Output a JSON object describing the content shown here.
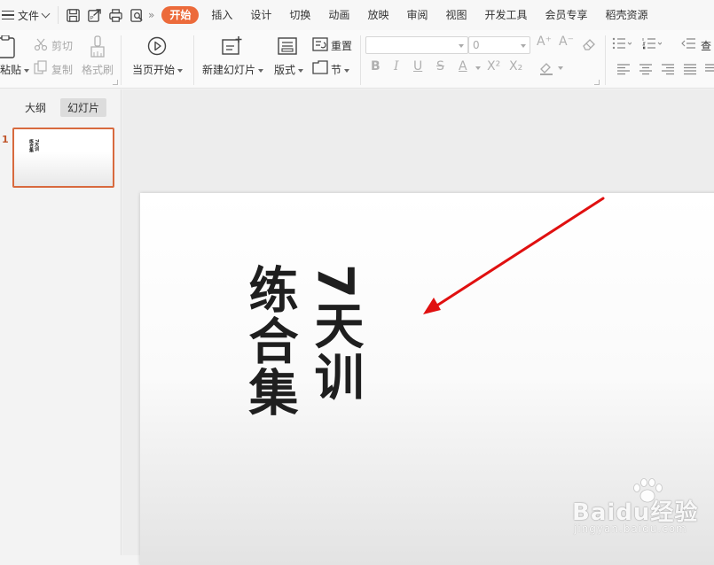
{
  "menubar": {
    "file_label": "文件",
    "more_label": "»",
    "quick_access_icons": [
      "save-icon",
      "export-icon",
      "print-icon",
      "print-preview-icon"
    ],
    "tabs": [
      {
        "label": "开始",
        "active": true
      },
      {
        "label": "插入"
      },
      {
        "label": "设计"
      },
      {
        "label": "切换"
      },
      {
        "label": "动画"
      },
      {
        "label": "放映"
      },
      {
        "label": "审阅"
      },
      {
        "label": "视图"
      },
      {
        "label": "开发工具"
      },
      {
        "label": "会员专享"
      },
      {
        "label": "稻壳资源"
      }
    ],
    "accent_color": "#ec6a3a"
  },
  "ribbon": {
    "paste_label": "粘贴",
    "cut_label": "剪切",
    "copy_label": "复制",
    "format_painter_label": "格式刷",
    "play_from_current_label": "当页开始",
    "new_slide_label": "新建幻灯片",
    "layout_label": "版式",
    "reset_label": "重置",
    "section_label": "节",
    "font_name_value": "",
    "font_size_value": "0",
    "right_cut_label": "查"
  },
  "left_panel": {
    "tabs": [
      {
        "label": "大纲"
      },
      {
        "label": "幻灯片",
        "active": true
      }
    ],
    "slides": [
      {
        "number": "1",
        "title_line1": "7天训",
        "title_line2": "练合集"
      }
    ]
  },
  "slide": {
    "title_line1": "7天训",
    "title_line2": "练合集",
    "annotation_color": "#e01010"
  },
  "watermark": {
    "brand": "Baidu经验",
    "url": "jingyan.baidu.com"
  }
}
